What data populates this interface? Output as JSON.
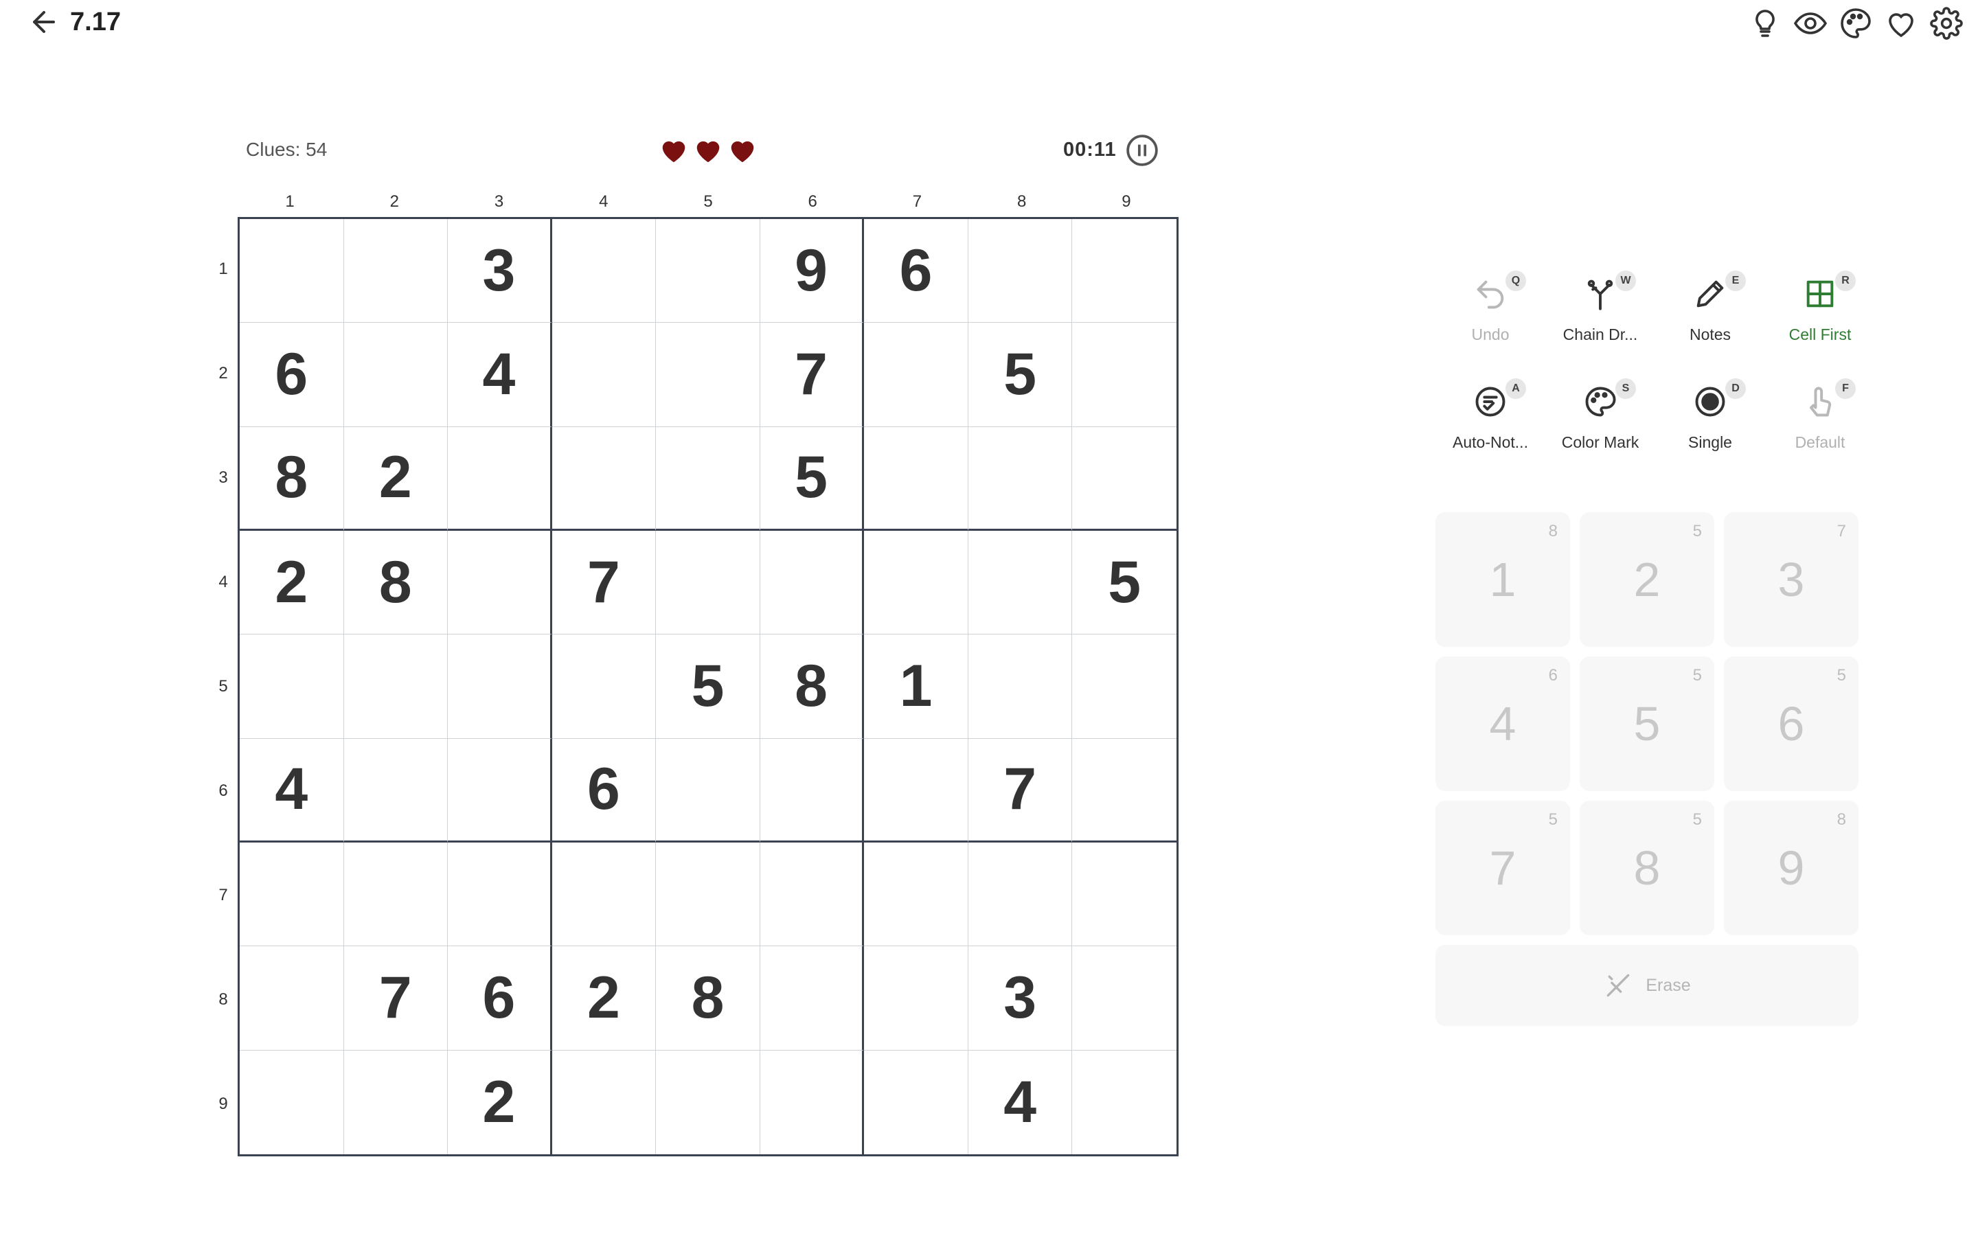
{
  "header": {
    "title": "7.17"
  },
  "top_icons": [
    "lightbulb-icon",
    "eye-icon",
    "palette-icon",
    "heart-icon",
    "gear-icon"
  ],
  "board": {
    "clues_label": "Clues: 54",
    "lives": 3,
    "timer": "00:11",
    "col_labels": [
      "1",
      "2",
      "3",
      "4",
      "5",
      "6",
      "7",
      "8",
      "9"
    ],
    "row_labels": [
      "1",
      "2",
      "3",
      "4",
      "5",
      "6",
      "7",
      "8",
      "9"
    ],
    "cells": [
      [
        "",
        "",
        "3",
        "",
        "",
        "9",
        "6",
        "",
        ""
      ],
      [
        "6",
        "",
        "4",
        "",
        "",
        "7",
        "",
        "5",
        ""
      ],
      [
        "8",
        "2",
        "",
        "",
        "",
        "5",
        "",
        "",
        ""
      ],
      [
        "2",
        "8",
        "",
        "7",
        "",
        "",
        "",
        "",
        "5"
      ],
      [
        "",
        "",
        "",
        "",
        "5",
        "8",
        "1",
        "",
        ""
      ],
      [
        "4",
        "",
        "",
        "6",
        "",
        "",
        "",
        "7",
        ""
      ],
      [
        "",
        "",
        "",
        "",
        "",
        "",
        "",
        "",
        ""
      ],
      [
        "",
        "7",
        "6",
        "2",
        "8",
        "",
        "",
        "3",
        ""
      ],
      [
        "",
        "",
        "2",
        "",
        "",
        "",
        "",
        "4",
        ""
      ]
    ]
  },
  "colors": {
    "heart": "#7a1010",
    "active": "#2e7d32",
    "grid_border": "#3b4252"
  },
  "tools": [
    {
      "label": "Undo",
      "key": "Q",
      "icon": "undo-icon",
      "state": "disabled"
    },
    {
      "label": "Chain Dr...",
      "key": "W",
      "icon": "chain-draw-icon",
      "state": "normal"
    },
    {
      "label": "Notes",
      "key": "E",
      "icon": "pencil-icon",
      "state": "normal"
    },
    {
      "label": "Cell First",
      "key": "R",
      "icon": "grid-icon",
      "state": "active"
    },
    {
      "label": "Auto-Not...",
      "key": "A",
      "icon": "auto-notes-icon",
      "state": "normal"
    },
    {
      "label": "Color Mark",
      "key": "S",
      "icon": "palette-icon",
      "state": "normal"
    },
    {
      "label": "Single",
      "key": "D",
      "icon": "target-icon",
      "state": "normal"
    },
    {
      "label": "Default",
      "key": "F",
      "icon": "tap-icon",
      "state": "disabled"
    }
  ],
  "numpad": [
    {
      "value": "1",
      "count": "8"
    },
    {
      "value": "2",
      "count": "5"
    },
    {
      "value": "3",
      "count": "7"
    },
    {
      "value": "4",
      "count": "6"
    },
    {
      "value": "5",
      "count": "5"
    },
    {
      "value": "6",
      "count": "5"
    },
    {
      "value": "7",
      "count": "5"
    },
    {
      "value": "8",
      "count": "5"
    },
    {
      "value": "9",
      "count": "8"
    }
  ],
  "erase": {
    "label": "Erase"
  }
}
